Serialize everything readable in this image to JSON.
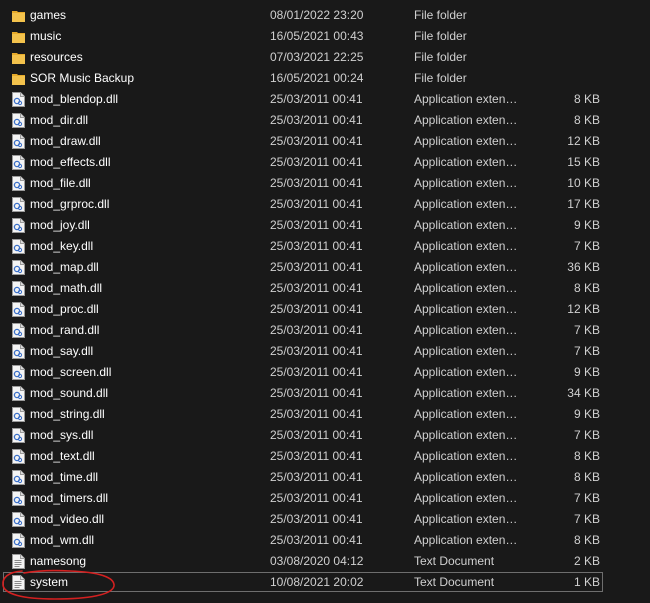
{
  "items": [
    {
      "name": "games",
      "date": "08/01/2022 23:20",
      "type": "File folder",
      "size": "",
      "icon": "folder-icon"
    },
    {
      "name": "music",
      "date": "16/05/2021 00:43",
      "type": "File folder",
      "size": "",
      "icon": "folder-icon"
    },
    {
      "name": "resources",
      "date": "07/03/2021 22:25",
      "type": "File folder",
      "size": "",
      "icon": "folder-icon"
    },
    {
      "name": "SOR Music Backup",
      "date": "16/05/2021 00:24",
      "type": "File folder",
      "size": "",
      "icon": "folder-icon"
    },
    {
      "name": "mod_blendop.dll",
      "date": "25/03/2011 00:41",
      "type": "Application exten…",
      "size": "8 KB",
      "icon": "dll-file-icon"
    },
    {
      "name": "mod_dir.dll",
      "date": "25/03/2011 00:41",
      "type": "Application exten…",
      "size": "8 KB",
      "icon": "dll-file-icon"
    },
    {
      "name": "mod_draw.dll",
      "date": "25/03/2011 00:41",
      "type": "Application exten…",
      "size": "12 KB",
      "icon": "dll-file-icon"
    },
    {
      "name": "mod_effects.dll",
      "date": "25/03/2011 00:41",
      "type": "Application exten…",
      "size": "15 KB",
      "icon": "dll-file-icon"
    },
    {
      "name": "mod_file.dll",
      "date": "25/03/2011 00:41",
      "type": "Application exten…",
      "size": "10 KB",
      "icon": "dll-file-icon"
    },
    {
      "name": "mod_grproc.dll",
      "date": "25/03/2011 00:41",
      "type": "Application exten…",
      "size": "17 KB",
      "icon": "dll-file-icon"
    },
    {
      "name": "mod_joy.dll",
      "date": "25/03/2011 00:41",
      "type": "Application exten…",
      "size": "9 KB",
      "icon": "dll-file-icon"
    },
    {
      "name": "mod_key.dll",
      "date": "25/03/2011 00:41",
      "type": "Application exten…",
      "size": "7 KB",
      "icon": "dll-file-icon"
    },
    {
      "name": "mod_map.dll",
      "date": "25/03/2011 00:41",
      "type": "Application exten…",
      "size": "36 KB",
      "icon": "dll-file-icon"
    },
    {
      "name": "mod_math.dll",
      "date": "25/03/2011 00:41",
      "type": "Application exten…",
      "size": "8 KB",
      "icon": "dll-file-icon"
    },
    {
      "name": "mod_proc.dll",
      "date": "25/03/2011 00:41",
      "type": "Application exten…",
      "size": "12 KB",
      "icon": "dll-file-icon"
    },
    {
      "name": "mod_rand.dll",
      "date": "25/03/2011 00:41",
      "type": "Application exten…",
      "size": "7 KB",
      "icon": "dll-file-icon"
    },
    {
      "name": "mod_say.dll",
      "date": "25/03/2011 00:41",
      "type": "Application exten…",
      "size": "7 KB",
      "icon": "dll-file-icon"
    },
    {
      "name": "mod_screen.dll",
      "date": "25/03/2011 00:41",
      "type": "Application exten…",
      "size": "9 KB",
      "icon": "dll-file-icon"
    },
    {
      "name": "mod_sound.dll",
      "date": "25/03/2011 00:41",
      "type": "Application exten…",
      "size": "34 KB",
      "icon": "dll-file-icon"
    },
    {
      "name": "mod_string.dll",
      "date": "25/03/2011 00:41",
      "type": "Application exten…",
      "size": "9 KB",
      "icon": "dll-file-icon"
    },
    {
      "name": "mod_sys.dll",
      "date": "25/03/2011 00:41",
      "type": "Application exten…",
      "size": "7 KB",
      "icon": "dll-file-icon"
    },
    {
      "name": "mod_text.dll",
      "date": "25/03/2011 00:41",
      "type": "Application exten…",
      "size": "8 KB",
      "icon": "dll-file-icon"
    },
    {
      "name": "mod_time.dll",
      "date": "25/03/2011 00:41",
      "type": "Application exten…",
      "size": "8 KB",
      "icon": "dll-file-icon"
    },
    {
      "name": "mod_timers.dll",
      "date": "25/03/2011 00:41",
      "type": "Application exten…",
      "size": "7 KB",
      "icon": "dll-file-icon"
    },
    {
      "name": "mod_video.dll",
      "date": "25/03/2011 00:41",
      "type": "Application exten…",
      "size": "7 KB",
      "icon": "dll-file-icon"
    },
    {
      "name": "mod_wm.dll",
      "date": "25/03/2011 00:41",
      "type": "Application exten…",
      "size": "8 KB",
      "icon": "dll-file-icon"
    },
    {
      "name": "namesong",
      "date": "03/08/2020 04:12",
      "type": "Text Document",
      "size": "2 KB",
      "icon": "text-file-icon"
    },
    {
      "name": "system",
      "date": "10/08/2021 20:02",
      "type": "Text Document",
      "size": "1 KB",
      "icon": "text-file-icon",
      "selected": true
    }
  ],
  "colors": {
    "background": "#191919",
    "text": "#ffffff",
    "folder": "#f3c24c",
    "selection_border": "#6e6e6e",
    "annotation": "#d42020"
  }
}
